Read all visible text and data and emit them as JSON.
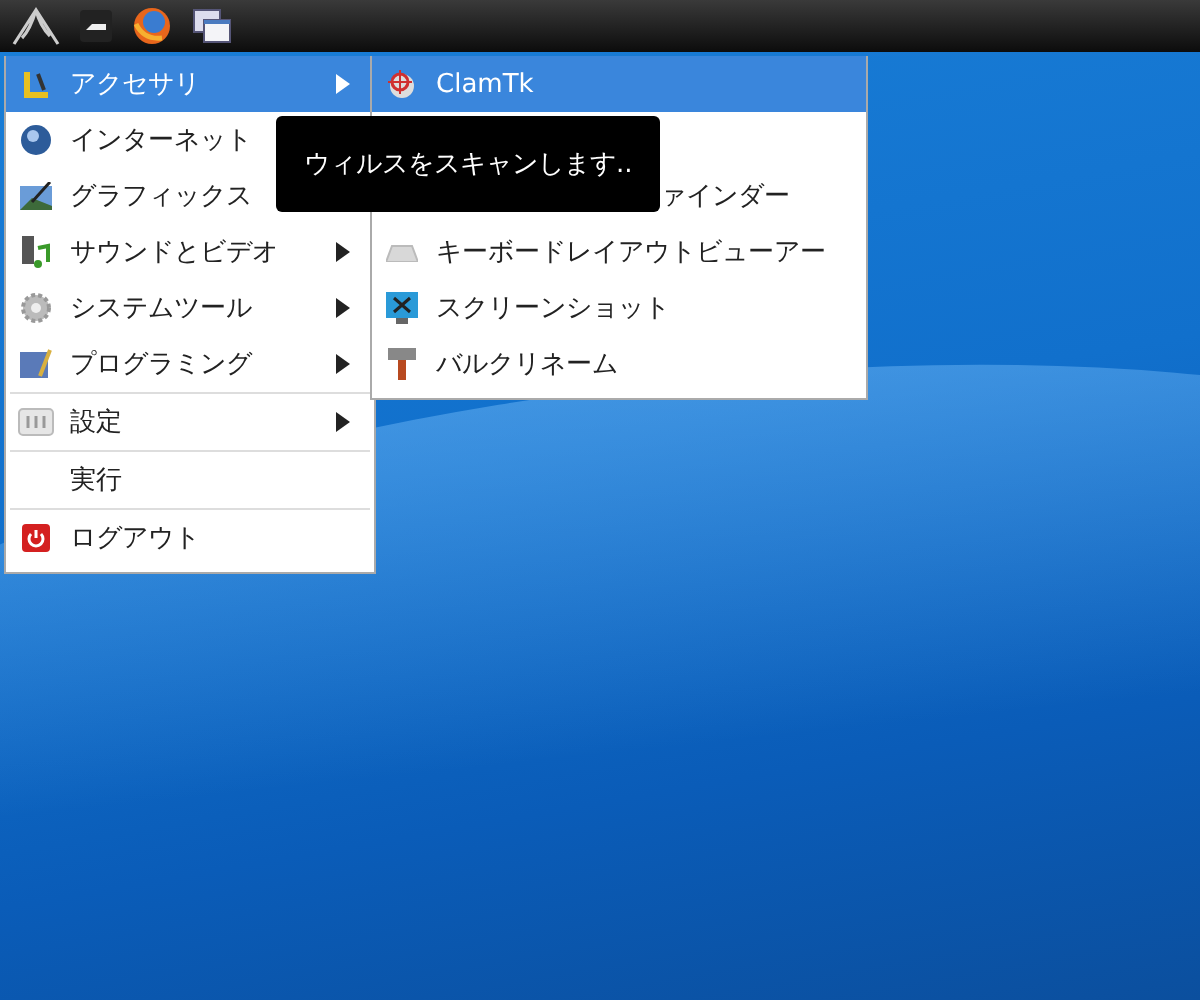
{
  "taskbar": {
    "launchers": [
      {
        "kind": "logo"
      },
      {
        "kind": "box"
      },
      {
        "kind": "globe"
      },
      {
        "kind": "windows"
      }
    ]
  },
  "menu": {
    "items": [
      {
        "kind": "item",
        "label": "アクセサリ",
        "submenu": true,
        "selected": true
      },
      {
        "kind": "item",
        "label": "インターネット",
        "submenu": false,
        "selected": false
      },
      {
        "kind": "item",
        "label": "グラフィックス",
        "submenu": false,
        "selected": false
      },
      {
        "kind": "item",
        "label": "サウンドとビデオ",
        "submenu": true,
        "selected": false
      },
      {
        "kind": "item",
        "label": "システムツール",
        "submenu": true,
        "selected": false
      },
      {
        "kind": "item",
        "label": "プログラミング",
        "submenu": true,
        "selected": false
      },
      {
        "kind": "separator"
      },
      {
        "kind": "item",
        "label": "設定",
        "submenu": true,
        "selected": false
      },
      {
        "kind": "separator"
      },
      {
        "kind": "item",
        "label": "実行",
        "submenu": false,
        "selected": false
      },
      {
        "kind": "separator"
      },
      {
        "kind": "item",
        "label": "ログアウト",
        "submenu": false,
        "selected": false
      }
    ]
  },
  "submenu": {
    "items": [
      {
        "kind": "item",
        "label": "ClamTk",
        "selected": true
      },
      {
        "kind": "partial",
        "label": "ァインダー",
        "selected": false
      },
      {
        "kind": "item",
        "label": "キーボードレイアウトビューアー",
        "selected": false
      },
      {
        "kind": "item",
        "label": "スクリーンショット",
        "selected": false
      },
      {
        "kind": "item",
        "label": "バルクリネーム",
        "selected": false
      }
    ]
  },
  "tooltip": {
    "text": "ウィルスをスキャンします.."
  }
}
